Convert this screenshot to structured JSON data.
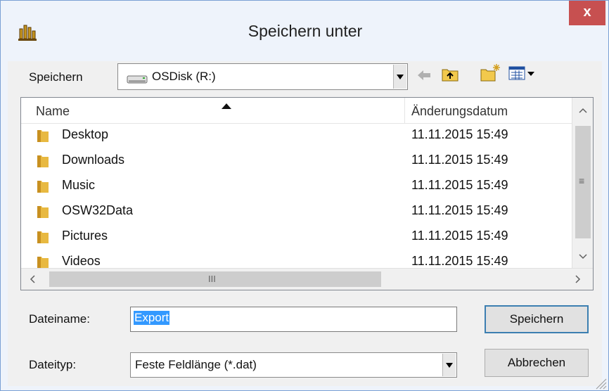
{
  "window": {
    "title": "Speichern unter",
    "close_label": "x"
  },
  "save_in": {
    "label": "Speichern",
    "location": "OSDisk (R:)"
  },
  "toolbar": {
    "icons": [
      "back-arrow-icon",
      "up-folder-icon",
      "new-folder-icon",
      "view-menu-icon"
    ]
  },
  "file_list": {
    "columns": [
      "Name",
      "Änderungsdatum"
    ],
    "rows": [
      {
        "name": "Desktop",
        "date": "11.11.2015 15:49"
      },
      {
        "name": "Downloads",
        "date": "11.11.2015 15:49"
      },
      {
        "name": "Music",
        "date": "11.11.2015 15:49"
      },
      {
        "name": "OSW32Data",
        "date": "11.11.2015 15:49"
      },
      {
        "name": "Pictures",
        "date": "11.11.2015 15:49"
      },
      {
        "name": "Videos",
        "date": "11.11.2015 15:49"
      }
    ],
    "scroll_glyph_v": "≡",
    "scroll_glyph_h": "III"
  },
  "filename": {
    "label": "Dateiname:",
    "value": "Export"
  },
  "filetype": {
    "label": "Dateityp:",
    "value": "Feste Feldlänge (*.dat)"
  },
  "buttons": {
    "save": "Speichern",
    "cancel": "Abbrechen"
  },
  "colors": {
    "title_bg": "#eef3fb",
    "close_bg": "#c75050",
    "selection": "#3399ff",
    "folder": "#e8b941"
  }
}
